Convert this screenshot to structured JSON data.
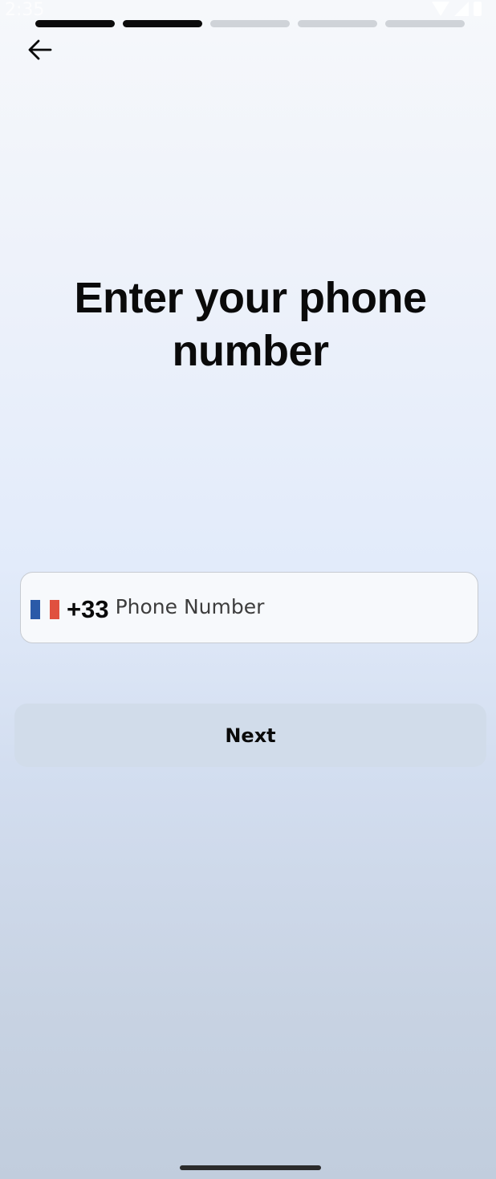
{
  "status_bar": {
    "time": "2:35",
    "icons": [
      "wifi-icon",
      "signal-icon",
      "battery-icon"
    ]
  },
  "progress": {
    "total_steps": 5,
    "completed_steps": 2
  },
  "header": {
    "back_icon": "arrow-left-icon"
  },
  "title": "Enter your phone number",
  "phone": {
    "country_flag": "france-flag-icon",
    "dial_code": "+33",
    "placeholder": "Phone Number",
    "value": ""
  },
  "next_button": {
    "label": "Next"
  },
  "colors": {
    "progress_done": "#0c0c0c",
    "progress_pending": "#cfd3d8",
    "button_bg": "#d1dcea",
    "field_border": "#c7cbd1",
    "flag_blue": "#2a5aa8",
    "flag_red": "#e0503f"
  }
}
